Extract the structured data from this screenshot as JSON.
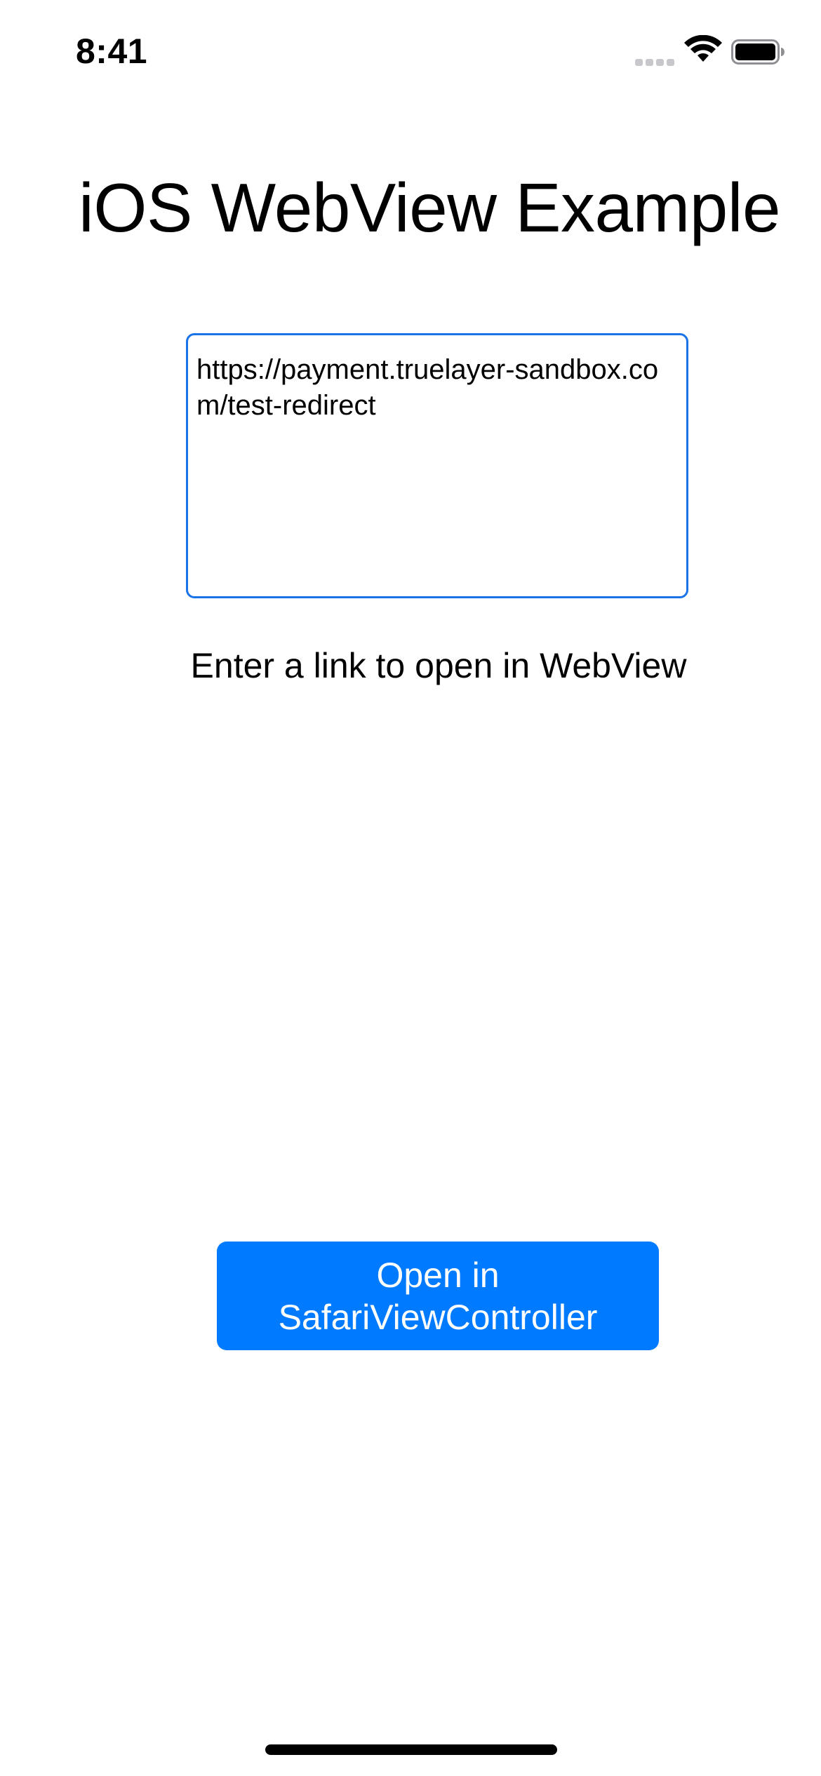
{
  "status_bar": {
    "time": "8:41",
    "icons": [
      "cellular-signal-icon",
      "wifi-icon",
      "battery-icon"
    ]
  },
  "screen": {
    "title": "iOS WebView Example",
    "url_field": {
      "value": "https://payment.truelayer-sandbox.com/test-redirect"
    },
    "hint_label": "Enter a link to open in WebView",
    "open_button_label": "Open in SafariViewController"
  },
  "colors": {
    "accent": "#007aff",
    "field_border": "#1a73e8",
    "background": "#ffffff",
    "text": "#000000"
  }
}
